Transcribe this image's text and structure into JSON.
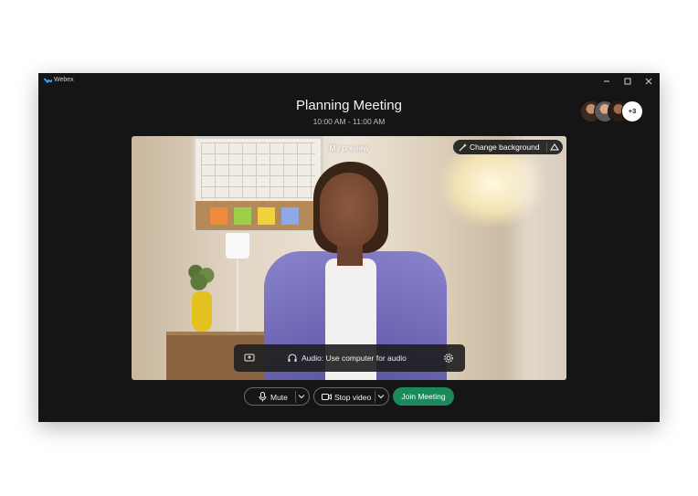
{
  "window": {
    "app_name": "Webex",
    "logo_icon": "webex-logo-icon",
    "controls": [
      "minimize-icon",
      "maximize-icon",
      "close-icon"
    ]
  },
  "meeting": {
    "title": "Planning Meeting",
    "time": "10:00 AM - 11:00 AM"
  },
  "participants": {
    "more_count": "+3"
  },
  "preview": {
    "label": "My preview",
    "change_background_label": "Change background",
    "change_background_icon": "magic-wand-icon",
    "layout_icon": "layout-icon"
  },
  "audio": {
    "label": "Audio: Use computer for audio",
    "share_icon": "share-screen-icon",
    "headset_icon": "headset-icon",
    "settings_icon": "gear-icon"
  },
  "controls": {
    "mute_label": "Mute",
    "stop_video_label": "Stop video",
    "join_label": "Join Meeting"
  },
  "colors": {
    "window_bg": "#151515",
    "join_button": "#1b8a5a",
    "text_primary": "#f2f2f2"
  }
}
